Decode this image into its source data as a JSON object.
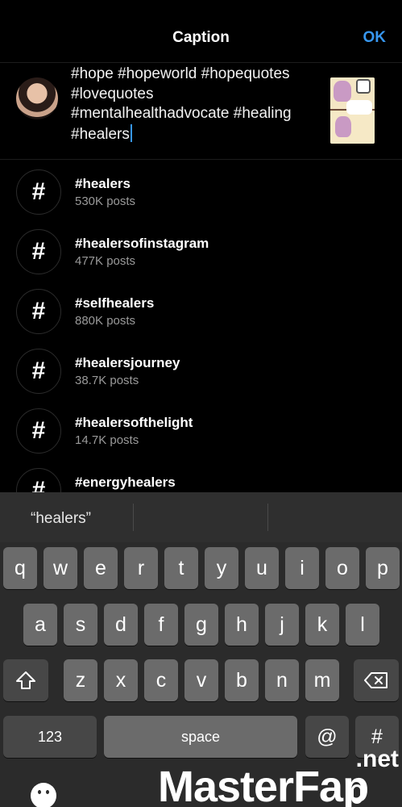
{
  "header": {
    "title": "Caption",
    "ok_label": "OK"
  },
  "caption": {
    "line1": "#hope #hopeworld #hopequotes",
    "line2": "#lovequotes",
    "line3": "#mentalhealthadvocate #healing",
    "line4": "#healers"
  },
  "suggestions": [
    {
      "tag": "#healers",
      "count": "530K posts"
    },
    {
      "tag": "#healersofinstagram",
      "count": "477K posts"
    },
    {
      "tag": "#selfhealers",
      "count": "880K posts"
    },
    {
      "tag": "#healersjourney",
      "count": "38.7K posts"
    },
    {
      "tag": "#healersofthelight",
      "count": "14.7K posts"
    },
    {
      "tag": "#energyhealers",
      "count": ""
    }
  ],
  "hash_symbol": "#",
  "keyboard": {
    "prediction": "“healers”",
    "row1": [
      "q",
      "w",
      "e",
      "r",
      "t",
      "y",
      "u",
      "i",
      "o",
      "p"
    ],
    "row2": [
      "a",
      "s",
      "d",
      "f",
      "g",
      "h",
      "j",
      "k",
      "l"
    ],
    "row3": [
      "z",
      "x",
      "c",
      "v",
      "b",
      "n",
      "m"
    ],
    "numbers_label": "123",
    "space_label": "space",
    "at_label": "@",
    "hash_label": "#"
  },
  "watermark": {
    "net": ".net",
    "brand": "MasterFap"
  },
  "icons": {
    "shift": "shift-icon",
    "backspace": "backspace-icon",
    "emoji": "emoji-icon",
    "mic": "microphone-icon"
  }
}
